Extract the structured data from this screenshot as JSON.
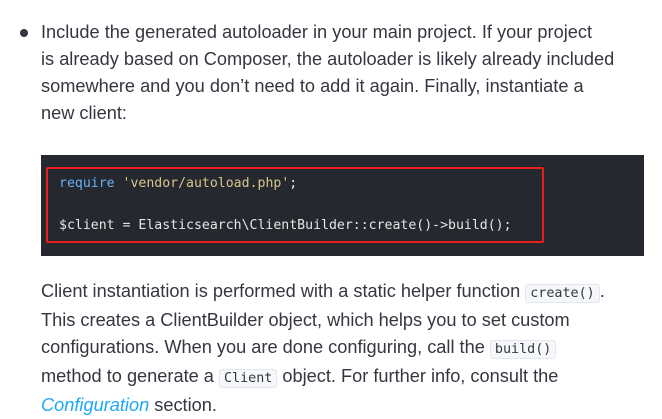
{
  "bullet_paragraph": {
    "lines": [
      "Include the generated autoloader in your main project. If your project",
      "is already based on Composer, the autoloader is likely already included",
      "somewhere and you don’t need to add it again. Finally, instantiate a",
      "new client:"
    ]
  },
  "code_block": {
    "line1": {
      "keyword": "require",
      "string": "'vendor/autoload.php'",
      "end": ";"
    },
    "line2": "$client = Elasticsearch\\ClientBuilder::create()->build();"
  },
  "explanation": {
    "line1_text": "Client instantiation is performed with a static helper function ",
    "line1_code": "create()",
    "line1_end": ".",
    "line2": "This creates a ClientBuilder object, which helps you to set custom",
    "line3_text": "configurations. When you are done configuring, call the ",
    "line3_code": "build()",
    "line4_text": "method to generate a ",
    "line4_code": "Client",
    "line4_end": " object. For further info, consult the",
    "line5_link": "Configuration",
    "line5_end": " section."
  },
  "colors": {
    "body_text": "#343741",
    "code_background": "#25282f",
    "highlight_border": "#e8201b",
    "keyword": "#6ab0f3",
    "string": "#d9c58b",
    "link": "#1ba9f5"
  }
}
